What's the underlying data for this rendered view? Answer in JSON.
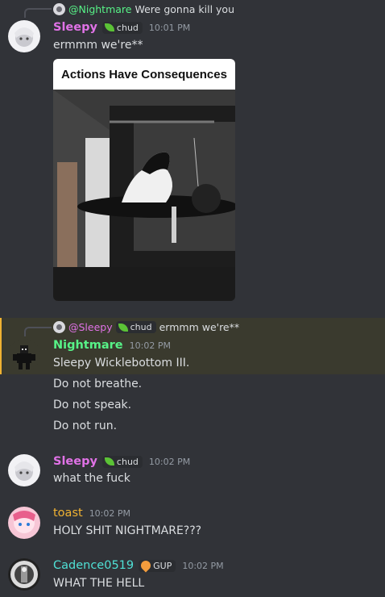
{
  "messages": [
    {
      "reply": {
        "mention": "@Nightmare",
        "text": "Were gonna kill you"
      },
      "author": "Sleepy",
      "tag": "chud",
      "time": "10:01 PM",
      "text": "ermmm we're**",
      "gif_title": "Actions Have Consequences"
    },
    {
      "reply": {
        "mention": "@Sleepy",
        "tag": "chud",
        "text": "ermmm we're**"
      },
      "author": "Nightmare",
      "time": "10:02 PM",
      "lines": [
        "Sleepy Wicklebottom III.",
        "Do not breathe.",
        "Do not speak.",
        "Do not run."
      ]
    },
    {
      "author": "Sleepy",
      "tag": "chud",
      "time": "10:02 PM",
      "text": "what the fuck"
    },
    {
      "author": "toast",
      "time": "10:02 PM",
      "text": "HOLY SHIT NIGHTMARE???"
    },
    {
      "author": "Cadence0519",
      "tag": "GUP",
      "time": "10:02 PM",
      "text": "WHAT THE HELL"
    }
  ],
  "colors": {
    "sleepy": "#e072e6",
    "nightmare": "#57f287",
    "toast": "#f0b232",
    "cadence": "#4fe0d5",
    "background": "#313338"
  },
  "icons": [
    "leaf-icon",
    "gup-icon"
  ]
}
